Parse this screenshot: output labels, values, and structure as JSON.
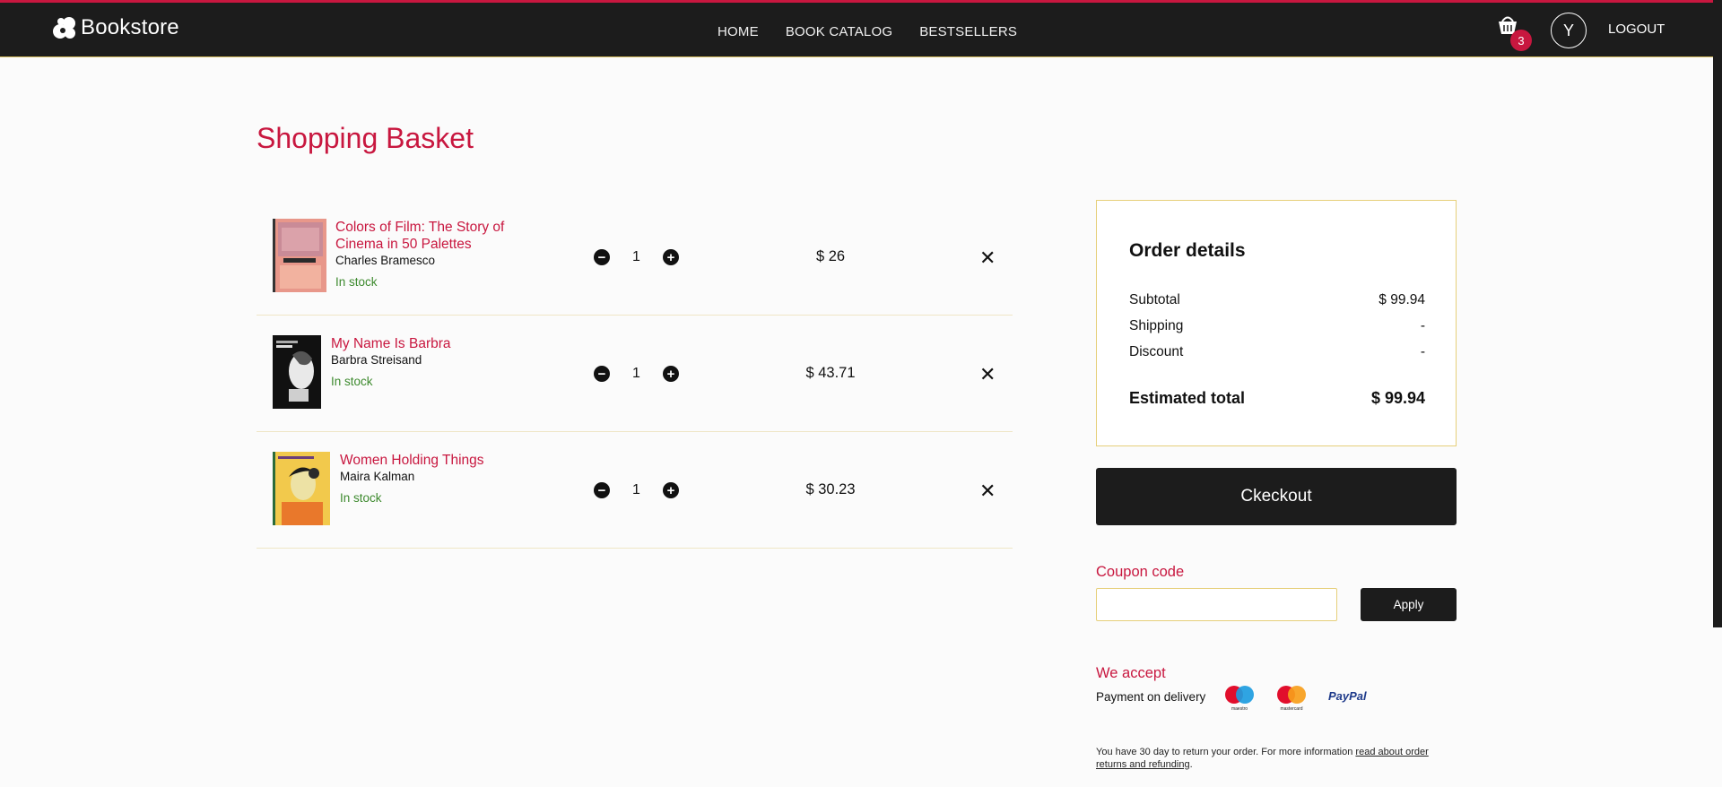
{
  "header": {
    "brand": "Bookstore",
    "nav": [
      "HOME",
      "BOOK CATALOG",
      "BESTSELLERS"
    ],
    "cart_count": "3",
    "avatar_initial": "Y",
    "logout": "LOGOUT"
  },
  "basket": {
    "title": "Shopping Basket",
    "items": [
      {
        "title": "Colors of Film: The Story of Cinema in 50 Palettes",
        "author": "Charles Bramesco",
        "stock": "In stock",
        "quantity": "1",
        "price": "$ 26"
      },
      {
        "title": "My Name Is Barbra",
        "author": "Barbra Streisand",
        "stock": "In stock",
        "quantity": "1",
        "price": "$ 43.71"
      },
      {
        "title": "Women Holding Things",
        "author": "Maira Kalman",
        "stock": "In stock",
        "quantity": "1",
        "price": "$ 30.23"
      }
    ]
  },
  "order": {
    "title": "Order details",
    "subtotal_label": "Subtotal",
    "subtotal_value": "$ 99.94",
    "shipping_label": "Shipping",
    "shipping_value": "-",
    "discount_label": "Discount",
    "discount_value": "-",
    "total_label": "Estimated total",
    "total_value": "$ 99.94",
    "checkout_label": "Ckeckout"
  },
  "coupon": {
    "label": "Coupon code",
    "value": "",
    "apply_label": "Apply"
  },
  "payment": {
    "label": "We accept",
    "delivery": "Payment on delivery",
    "methods": [
      "maestro",
      "mastercard",
      "PayPal"
    ]
  },
  "returns": {
    "text": "You have 30 day to return your order. For more information ",
    "link": "read about order returns and refunding",
    "tail": "."
  },
  "colors": {
    "accent": "#c8173f",
    "dark": "#1c1c1c",
    "border": "#e6cf7a",
    "stock": "#3d8a2e"
  }
}
